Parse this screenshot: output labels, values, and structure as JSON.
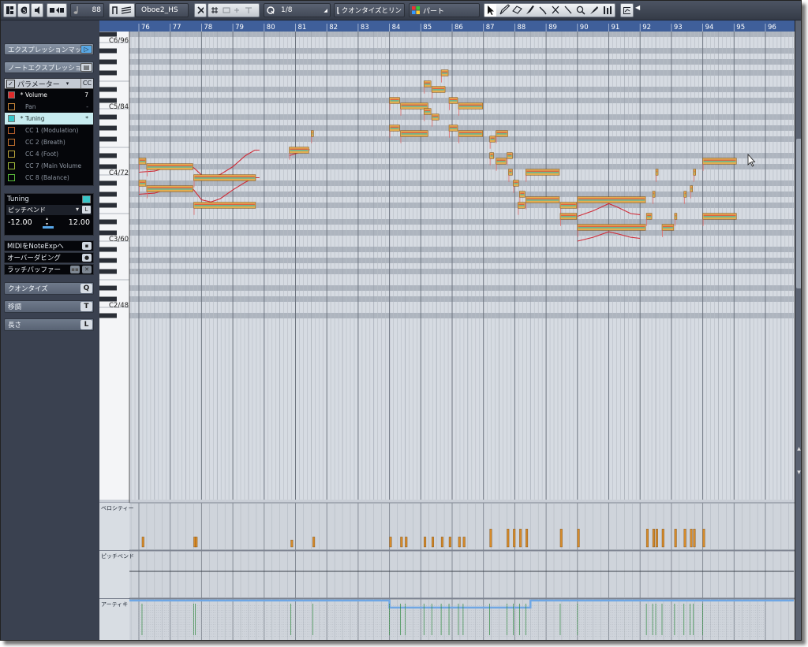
{
  "toolbar": {
    "velocity_value": "88",
    "instrument": "Oboe2_HS",
    "quantize": "1/8",
    "length_quantize": "クオンタイズとリン",
    "color_mode": "パート",
    "accent": "#58a8e6"
  },
  "inspector": {
    "expression_map": "エクスプレッションマップ",
    "note_expression": "ノートエクスプレッション",
    "param_header": "パラメーター",
    "param_header_cc": "CC",
    "params": [
      {
        "name": "Volume",
        "color": "#e02a2a",
        "star": "*",
        "value": "7",
        "state": "used"
      },
      {
        "name": "Pan",
        "color": "#c9873a",
        "star": "",
        "value": "-",
        "state": "idle"
      },
      {
        "name": "Tuning",
        "color": "#38c6c8",
        "star": "*",
        "value": "*",
        "state": "selected"
      },
      {
        "name": "CC 1  (Modulation)",
        "color": "#b35c2a",
        "star": "",
        "value": "",
        "state": "idle"
      },
      {
        "name": "CC 2  (Breath)",
        "color": "#c0702e",
        "star": "",
        "value": "",
        "state": "idle"
      },
      {
        "name": "CC 4  (Foot)",
        "color": "#b9a33a",
        "star": "",
        "value": "",
        "state": "idle"
      },
      {
        "name": "CC 7  (Main Volume",
        "color": "#9fba3a",
        "star": "",
        "value": "",
        "state": "idle"
      },
      {
        "name": "CC 8  (Balance)",
        "color": "#5aba3a",
        "star": "",
        "value": "",
        "state": "idle"
      }
    ],
    "tuning_label": "Tuning",
    "tuning_source": "ピッチベンド",
    "range_min": "-12.00",
    "range_max": "12.00",
    "options": [
      "MIDIをNoteExpへ",
      "オーバーダビング",
      "ラッチバッファー"
    ],
    "sections": [
      {
        "label": "クオンタイズ",
        "key": "Q"
      },
      {
        "label": "移調",
        "key": "T"
      },
      {
        "label": "長さ",
        "key": "L"
      }
    ]
  },
  "editor": {
    "bars": [
      "76",
      "77",
      "78",
      "79",
      "80",
      "81",
      "82",
      "83",
      "84",
      "85",
      "86",
      "87",
      "88",
      "89",
      "90",
      "91",
      "92",
      "93",
      "94",
      "95",
      "96"
    ],
    "octave_labels": [
      {
        "label": "C6/96",
        "midi": 96
      },
      {
        "label": "C5/84",
        "midi": 84
      },
      {
        "label": "C4/72",
        "midi": 72
      },
      {
        "label": "C3/60",
        "midi": 60
      },
      {
        "label": "C2/48",
        "midi": 48
      }
    ],
    "lanes": [
      "ベロシティー",
      "ピッチベンド",
      "アーティキ"
    ],
    "colors": {
      "background": "#d6dbe2",
      "black_key_row": "#aeb5bf",
      "note_fill": "#e3ad4f",
      "note_border": "#8a5a1e",
      "expression_curve": "#d02a36",
      "ruler": "#3f5f9a",
      "velocity_bar": "#d68b2a"
    }
  },
  "chart_data": {
    "type": "piano-roll",
    "x_unit": "bar",
    "y_unit": "midi_pitch",
    "notes": [
      {
        "bar": 76.0,
        "len": 0.25,
        "pitch": 74
      },
      {
        "bar": 76.0,
        "len": 0.25,
        "pitch": 70
      },
      {
        "bar": 76.25,
        "len": 1.5,
        "pitch": 73
      },
      {
        "bar": 76.25,
        "len": 1.5,
        "pitch": 69
      },
      {
        "bar": 77.75,
        "len": 2.0,
        "pitch": 71
      },
      {
        "bar": 77.75,
        "len": 2.0,
        "pitch": 66
      },
      {
        "bar": 80.8,
        "len": 0.65,
        "pitch": 76
      },
      {
        "bar": 81.5,
        "len": 0.1,
        "pitch": 79
      },
      {
        "bar": 84.0,
        "len": 0.35,
        "pitch": 85
      },
      {
        "bar": 84.0,
        "len": 0.35,
        "pitch": 80
      },
      {
        "bar": 84.35,
        "len": 0.9,
        "pitch": 84
      },
      {
        "bar": 84.35,
        "len": 0.9,
        "pitch": 79
      },
      {
        "bar": 85.1,
        "len": 0.25,
        "pitch": 83
      },
      {
        "bar": 85.35,
        "len": 0.25,
        "pitch": 82
      },
      {
        "bar": 85.1,
        "len": 0.25,
        "pitch": 88
      },
      {
        "bar": 85.35,
        "len": 0.45,
        "pitch": 87
      },
      {
        "bar": 85.65,
        "len": 0.25,
        "pitch": 90
      },
      {
        "bar": 85.9,
        "len": 0.3,
        "pitch": 85
      },
      {
        "bar": 86.2,
        "len": 0.8,
        "pitch": 84
      },
      {
        "bar": 85.9,
        "len": 0.3,
        "pitch": 80
      },
      {
        "bar": 86.2,
        "len": 0.8,
        "pitch": 79
      },
      {
        "bar": 87.2,
        "len": 0.2,
        "pitch": 78
      },
      {
        "bar": 87.4,
        "len": 0.4,
        "pitch": 79
      },
      {
        "bar": 87.2,
        "len": 0.15,
        "pitch": 75
      },
      {
        "bar": 87.4,
        "len": 0.35,
        "pitch": 74
      },
      {
        "bar": 87.75,
        "len": 0.2,
        "pitch": 75
      },
      {
        "bar": 87.8,
        "len": 0.15,
        "pitch": 72
      },
      {
        "bar": 87.95,
        "len": 0.2,
        "pitch": 70
      },
      {
        "bar": 88.15,
        "len": 0.2,
        "pitch": 68
      },
      {
        "bar": 88.35,
        "len": 1.1,
        "pitch": 72
      },
      {
        "bar": 88.35,
        "len": 1.1,
        "pitch": 67
      },
      {
        "bar": 88.1,
        "len": 0.25,
        "pitch": 66
      },
      {
        "bar": 89.45,
        "len": 0.55,
        "pitch": 66
      },
      {
        "bar": 89.45,
        "len": 0.55,
        "pitch": 64
      },
      {
        "bar": 90.0,
        "len": 2.2,
        "pitch": 67
      },
      {
        "bar": 90.0,
        "len": 2.2,
        "pitch": 62
      },
      {
        "bar": 92.2,
        "len": 0.2,
        "pitch": 64
      },
      {
        "bar": 92.4,
        "len": 0.1,
        "pitch": 68
      },
      {
        "bar": 92.5,
        "len": 0.1,
        "pitch": 72
      },
      {
        "bar": 92.7,
        "len": 0.4,
        "pitch": 62
      },
      {
        "bar": 93.1,
        "len": 0.1,
        "pitch": 64
      },
      {
        "bar": 93.4,
        "len": 0.1,
        "pitch": 68
      },
      {
        "bar": 93.6,
        "len": 0.1,
        "pitch": 69
      },
      {
        "bar": 93.7,
        "len": 0.1,
        "pitch": 72
      },
      {
        "bar": 94.0,
        "len": 1.1,
        "pitch": 74
      },
      {
        "bar": 94.0,
        "len": 1.1,
        "pitch": 64
      }
    ],
    "velocities": [
      {
        "bar": 76.1,
        "value": 40
      },
      {
        "bar": 77.75,
        "value": 40
      },
      {
        "bar": 77.8,
        "value": 40
      },
      {
        "bar": 80.85,
        "value": 28
      },
      {
        "bar": 81.55,
        "value": 40
      },
      {
        "bar": 84.0,
        "value": 40
      },
      {
        "bar": 84.35,
        "value": 40
      },
      {
        "bar": 84.5,
        "value": 40
      },
      {
        "bar": 85.1,
        "value": 40
      },
      {
        "bar": 85.35,
        "value": 40
      },
      {
        "bar": 85.65,
        "value": 40
      },
      {
        "bar": 85.9,
        "value": 40
      },
      {
        "bar": 86.2,
        "value": 40
      },
      {
        "bar": 86.35,
        "value": 40
      },
      {
        "bar": 87.2,
        "value": 72
      },
      {
        "bar": 87.75,
        "value": 72
      },
      {
        "bar": 87.95,
        "value": 72
      },
      {
        "bar": 88.15,
        "value": 72
      },
      {
        "bar": 88.35,
        "value": 72
      },
      {
        "bar": 89.45,
        "value": 72
      },
      {
        "bar": 90.0,
        "value": 72
      },
      {
        "bar": 92.2,
        "value": 72
      },
      {
        "bar": 92.4,
        "value": 72
      },
      {
        "bar": 92.5,
        "value": 72
      },
      {
        "bar": 92.7,
        "value": 72
      },
      {
        "bar": 93.1,
        "value": 72
      },
      {
        "bar": 93.4,
        "value": 72
      },
      {
        "bar": 93.6,
        "value": 72
      },
      {
        "bar": 93.7,
        "value": 72
      },
      {
        "bar": 94.0,
        "value": 72
      }
    ]
  }
}
